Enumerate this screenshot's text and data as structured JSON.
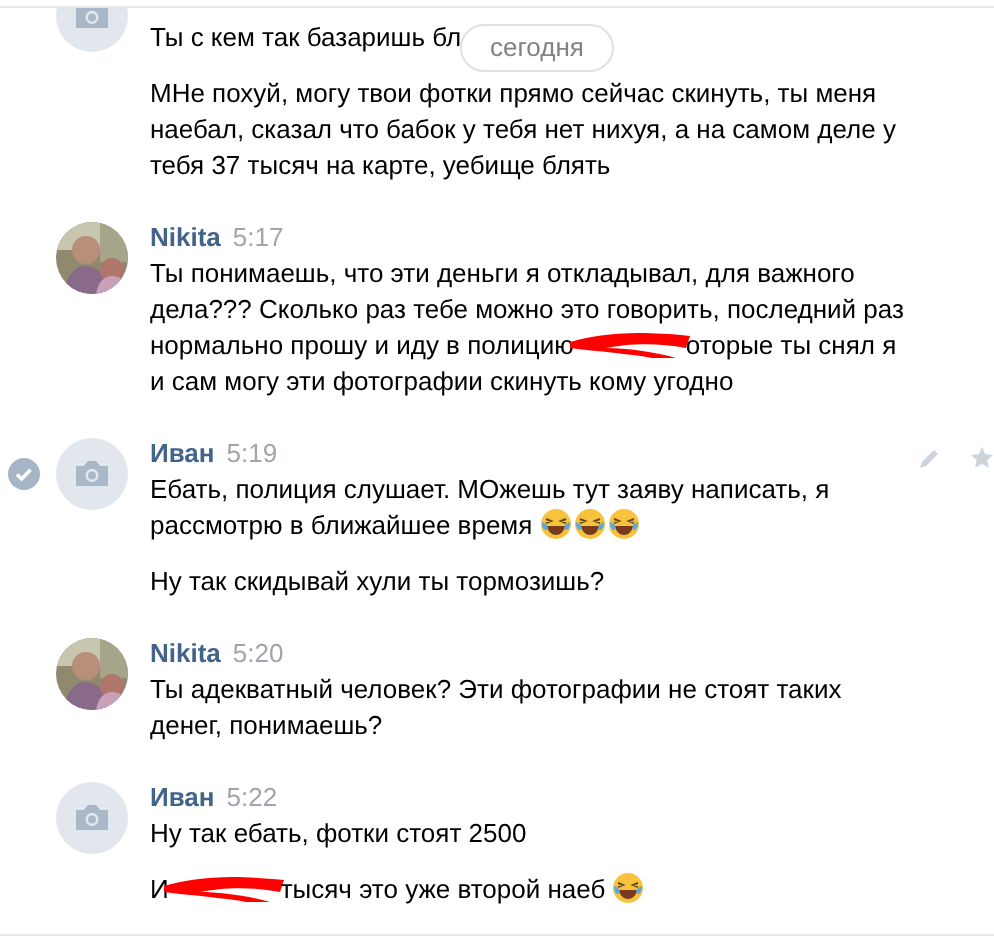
{
  "date_pill": "сегодня",
  "messages": [
    {
      "kind": "default_avatar",
      "hovered": false,
      "paragraphs": [
        [
          {
            "kind": "text",
            "text": "Ты с кем так базаришь бл"
          }
        ],
        [
          {
            "kind": "text",
            "text": "МНе похуй, могу твои фотки прямо сейчас скинуть, ты меня наебал, сказал что бабок у тебя нет нихуя, а на самом деле у тебя 37 тысяч на карте, уебище блять"
          }
        ]
      ]
    },
    {
      "author": "Nikita",
      "time": "5:17",
      "kind": "photo_avatar",
      "hovered": false,
      "paragraphs": [
        [
          {
            "kind": "text",
            "text": "Ты понимаешь, что эти деньги я откладывал, для важного дела??? Сколько раз тебе можно это говорить, последний раз нормально прошу и иду в полицию"
          },
          {
            "kind": "redaction"
          },
          {
            "kind": "text",
            "text": "оторые ты снял я и сам могу эти фотографии скинуть кому угодно"
          }
        ]
      ]
    },
    {
      "author": "Иван",
      "time": "5:19",
      "kind": "default_avatar",
      "hovered": true,
      "paragraphs": [
        [
          {
            "kind": "text",
            "text": "Ебать, полиция слушает. МОжешь тут заяву написать, я рассмотрю в ближайшее время "
          },
          {
            "kind": "emoji"
          },
          {
            "kind": "emoji"
          },
          {
            "kind": "emoji"
          }
        ],
        [
          {
            "kind": "text",
            "text": "Ну так скидывай хули ты тормозишь?"
          }
        ]
      ]
    },
    {
      "author": "Nikita",
      "time": "5:20",
      "kind": "photo_avatar",
      "hovered": false,
      "paragraphs": [
        [
          {
            "kind": "text",
            "text": "Ты адекватный человек? Эти фотографии не стоят таких денег, понимаешь?"
          }
        ]
      ]
    },
    {
      "author": "Иван",
      "time": "5:22",
      "kind": "default_avatar",
      "hovered": false,
      "paragraphs": [
        [
          {
            "kind": "text",
            "text": "Ну так ебать, фотки стоят 2500"
          }
        ],
        [
          {
            "kind": "text",
            "text": "И"
          },
          {
            "kind": "redaction"
          },
          {
            "kind": "text",
            "text": "тысяч это уже второй наеб "
          },
          {
            "kind": "emoji"
          }
        ]
      ]
    }
  ]
}
